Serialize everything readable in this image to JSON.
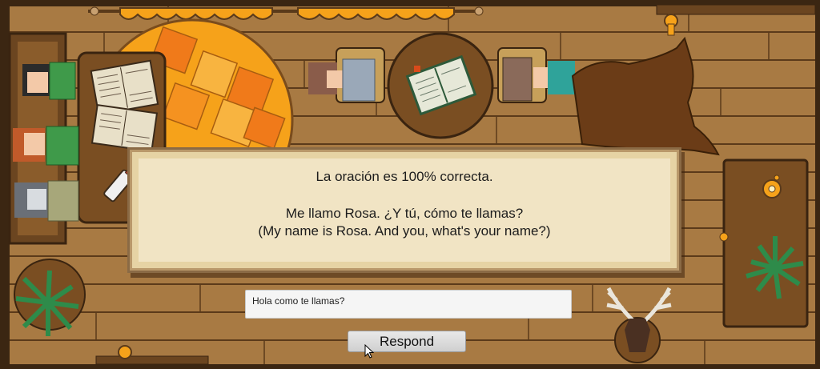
{
  "dialog": {
    "verdict": "La oración es 100% correcta.",
    "spanish": "Me llamo Rosa. ¿Y tú, cómo te llamas?",
    "english": "(My name is Rosa. And you, what's your name?)"
  },
  "answer_input": {
    "value": "Hola como te llamas?"
  },
  "respond_button": {
    "label": "Respond"
  },
  "colors": {
    "floor": "#a87a43",
    "rug": "#f6a21a",
    "dialog_bg": "#f1e4c4"
  }
}
